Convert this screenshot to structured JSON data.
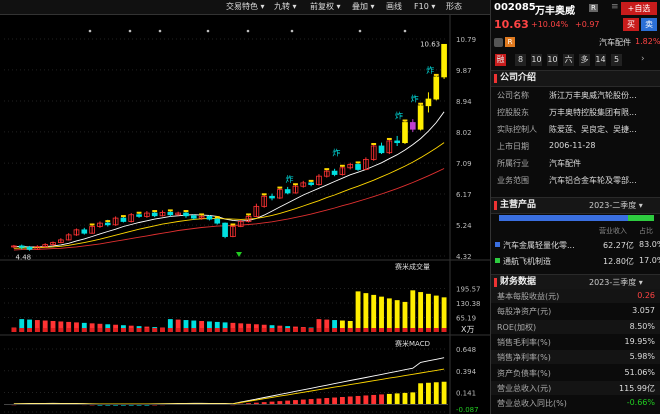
{
  "toolbar": {
    "items": [
      "交易特色",
      "九转",
      "前复权",
      "叠加",
      "画线",
      "F10",
      "形态"
    ]
  },
  "stock": {
    "code": "002085",
    "name": "万丰奥威",
    "badge": "R",
    "price": "10.63",
    "change_pct": "+10.04%",
    "change_abs": "+0.97",
    "buy_label": "买",
    "sell_label": "卖",
    "add_label": "+自选",
    "industry": "汽车配件",
    "industry_change": "1.82%",
    "r_badge": "R",
    "tabs": [
      "融",
      "8",
      "10",
      "10",
      "六",
      "多",
      "14",
      "5"
    ]
  },
  "company": {
    "section_title": "公司介绍",
    "rows": [
      {
        "label": "公司名称",
        "value": "浙江万丰奥威汽轮股份..."
      },
      {
        "label": "控股股东",
        "value": "万丰奥特控股集团有限..."
      },
      {
        "label": "实际控制人",
        "value": "陈爱莲、吴良定、吴捷..."
      },
      {
        "label": "上市日期",
        "value": "2006-11-28"
      },
      {
        "label": "所属行业",
        "value": "汽车配件"
      },
      {
        "label": "业务范围",
        "value": "汽车铝合金车轮及零部..."
      }
    ]
  },
  "products": {
    "section_title": "主营产品",
    "period": "2023-二季度",
    "headers": [
      "",
      "营业收入",
      "占比"
    ],
    "rows": [
      {
        "name": "汽车金属轻量化零...",
        "revenue": "62.27亿",
        "ratio": "83.0%",
        "color": "#3a6fe0"
      },
      {
        "name": "通航飞机制造",
        "revenue": "12.80亿",
        "ratio": "17.0%",
        "color": "#2ecc40"
      }
    ],
    "share_bar": [
      0.83,
      0.17
    ]
  },
  "finance": {
    "section_title": "财务数据",
    "period": "2023-三季度",
    "rows": [
      {
        "label": "基本每股收益(元)",
        "value": "0.26",
        "color": "#f44"
      },
      {
        "label": "每股净资产(元)",
        "value": "3.057",
        "color": "#ddd"
      },
      {
        "label": "ROE(加权)",
        "value": "8.50%",
        "color": "#ddd"
      },
      {
        "label": "销售毛利率(%)",
        "value": "19.95%",
        "color": "#ddd"
      },
      {
        "label": "销售净利率(%)",
        "value": "5.98%",
        "color": "#ddd"
      },
      {
        "label": "资产负债率(%)",
        "value": "51.06%",
        "color": "#ddd"
      },
      {
        "label": "营业总收入(元)",
        "value": "115.99亿",
        "color": "#ddd"
      },
      {
        "label": "营业总收入同比(%)",
        "value": "-0.66%",
        "color": "#2c2"
      }
    ]
  },
  "chart_data": [
    {
      "type": "candlestick",
      "y_ticks": [
        "10.79",
        "9.87",
        "8.94",
        "8.02",
        "7.09",
        "6.17",
        "5.24",
        "4.32"
      ],
      "ylim": [
        4.32,
        10.79
      ],
      "high_label": "10.63",
      "low_label": "4.48",
      "annotation": "炸",
      "candles": [
        [
          4.6,
          4.62,
          4.65,
          4.55
        ],
        [
          4.62,
          4.58,
          4.66,
          4.52
        ],
        [
          4.58,
          4.52,
          4.62,
          4.48
        ],
        [
          4.52,
          4.6,
          4.64,
          4.5
        ],
        [
          4.6,
          4.66,
          4.7,
          4.58
        ],
        [
          4.66,
          4.72,
          4.75,
          4.62
        ],
        [
          4.72,
          4.8,
          4.85,
          4.7
        ],
        [
          4.8,
          4.95,
          5.0,
          4.78
        ],
        [
          4.95,
          5.1,
          5.14,
          4.92
        ],
        [
          5.1,
          5.0,
          5.16,
          4.96
        ],
        [
          5.0,
          5.2,
          5.25,
          4.98
        ],
        [
          5.2,
          5.3,
          5.35,
          5.16
        ],
        [
          5.3,
          5.25,
          5.4,
          5.2
        ],
        [
          5.25,
          5.45,
          5.5,
          5.22
        ],
        [
          5.45,
          5.35,
          5.52,
          5.32
        ],
        [
          5.35,
          5.55,
          5.6,
          5.32
        ],
        [
          5.55,
          5.5,
          5.62,
          5.46
        ],
        [
          5.5,
          5.6,
          5.66,
          5.46
        ],
        [
          5.6,
          5.52,
          5.65,
          5.48
        ],
        [
          5.52,
          5.62,
          5.68,
          5.5
        ],
        [
          5.62,
          5.55,
          5.66,
          5.5
        ],
        [
          5.55,
          5.6,
          5.64,
          5.52
        ],
        [
          5.6,
          5.52,
          5.63,
          5.46
        ],
        [
          5.52,
          5.45,
          5.56,
          5.4
        ],
        [
          5.45,
          5.5,
          5.54,
          5.4
        ],
        [
          5.5,
          5.42,
          5.54,
          5.38
        ],
        [
          5.42,
          5.3,
          5.46,
          5.26
        ],
        [
          5.3,
          4.9,
          5.32,
          4.85
        ],
        [
          4.9,
          5.2,
          5.24,
          4.88
        ],
        [
          5.2,
          5.35,
          5.4,
          5.18
        ],
        [
          5.35,
          5.5,
          5.55,
          5.32
        ],
        [
          5.5,
          5.8,
          5.88,
          5.48
        ],
        [
          5.8,
          6.1,
          6.16,
          5.76
        ],
        [
          6.1,
          6.05,
          6.18,
          5.98
        ],
        [
          6.05,
          6.3,
          6.36,
          6.02
        ],
        [
          6.3,
          6.2,
          6.38,
          6.16
        ],
        [
          6.2,
          6.4,
          6.46,
          6.18
        ],
        [
          6.4,
          6.5,
          6.56,
          6.36
        ],
        [
          6.5,
          6.45,
          6.58,
          6.4
        ],
        [
          6.45,
          6.7,
          6.76,
          6.42
        ],
        [
          6.7,
          6.85,
          6.92,
          6.66
        ],
        [
          6.85,
          6.75,
          6.92,
          6.7
        ],
        [
          6.75,
          6.95,
          7.02,
          6.72
        ],
        [
          6.95,
          7.05,
          7.1,
          6.9
        ],
        [
          7.05,
          6.9,
          7.1,
          6.86
        ],
        [
          6.9,
          7.2,
          7.26,
          6.88
        ],
        [
          7.2,
          7.6,
          7.66,
          7.16
        ],
        [
          7.6,
          7.4,
          7.7,
          7.36
        ],
        [
          7.4,
          7.75,
          7.82,
          7.36
        ],
        [
          7.75,
          7.7,
          7.9,
          7.6
        ],
        [
          7.7,
          8.3,
          8.36,
          7.66
        ],
        [
          8.3,
          8.1,
          8.4,
          8.02
        ],
        [
          8.1,
          8.8,
          8.86,
          8.06
        ],
        [
          8.8,
          9.0,
          9.2,
          8.6
        ],
        [
          9.0,
          9.66,
          9.7,
          8.96
        ],
        [
          9.66,
          10.63,
          10.63,
          9.6
        ]
      ],
      "ma_lines": [
        {
          "color": "#ffffff",
          "values": [
            4.6,
            4.6,
            4.59,
            4.59,
            4.6,
            4.62,
            4.65,
            4.7,
            4.77,
            4.83,
            4.9,
            4.98,
            5.05,
            5.12,
            5.2,
            5.26,
            5.32,
            5.37,
            5.42,
            5.46,
            5.5,
            5.52,
            5.54,
            5.55,
            5.54,
            5.53,
            5.5,
            5.42,
            5.38,
            5.36,
            5.38,
            5.44,
            5.54,
            5.66,
            5.78,
            5.9,
            6.02,
            6.14,
            6.24,
            6.34,
            6.44,
            6.54,
            6.64,
            6.74,
            6.82,
            6.9,
            7.0,
            7.1,
            7.22,
            7.34,
            7.48,
            7.64,
            7.82,
            8.04,
            8.3,
            8.62
          ]
        },
        {
          "color": "#ffd700",
          "values": [
            4.55,
            4.56,
            4.56,
            4.57,
            4.58,
            4.59,
            4.61,
            4.64,
            4.68,
            4.72,
            4.77,
            4.82,
            4.88,
            4.94,
            5.0,
            5.06,
            5.12,
            5.17,
            5.22,
            5.27,
            5.31,
            5.35,
            5.38,
            5.41,
            5.43,
            5.44,
            5.44,
            5.43,
            5.42,
            5.41,
            5.42,
            5.44,
            5.48,
            5.53,
            5.59,
            5.66,
            5.73,
            5.81,
            5.89,
            5.97,
            6.06,
            6.14,
            6.23,
            6.32,
            6.4,
            6.49,
            6.58,
            6.68,
            6.78,
            6.89,
            7.0,
            7.12,
            7.25,
            7.39,
            7.54,
            7.7
          ]
        },
        {
          "color": "#e03030",
          "values": [
            4.5,
            4.51,
            4.51,
            4.52,
            4.53,
            4.54,
            4.55,
            4.57,
            4.59,
            4.62,
            4.65,
            4.68,
            4.72,
            4.76,
            4.8,
            4.84,
            4.88,
            4.92,
            4.96,
            5.0,
            5.04,
            5.08,
            5.11,
            5.14,
            5.17,
            5.19,
            5.21,
            5.22,
            5.23,
            5.24,
            5.26,
            5.28,
            5.31,
            5.34,
            5.38,
            5.42,
            5.47,
            5.52,
            5.57,
            5.63,
            5.69,
            5.75,
            5.82,
            5.88,
            5.95,
            6.02,
            6.09,
            6.17,
            6.25,
            6.33,
            6.42,
            6.51,
            6.61,
            6.71,
            6.82,
            6.93
          ]
        }
      ]
    },
    {
      "type": "bar",
      "title": "赛米成交量",
      "unit": "X万",
      "y_ticks": [
        "195.57",
        "130.38",
        "65.19"
      ],
      "ylim": [
        0,
        260.76
      ]
    },
    {
      "type": "bar",
      "title": "赛米MACD",
      "y_ticks": [
        "0.648",
        "0.394",
        "0.141",
        "-0.087"
      ],
      "ylim": [
        -0.087,
        0.648
      ]
    }
  ]
}
